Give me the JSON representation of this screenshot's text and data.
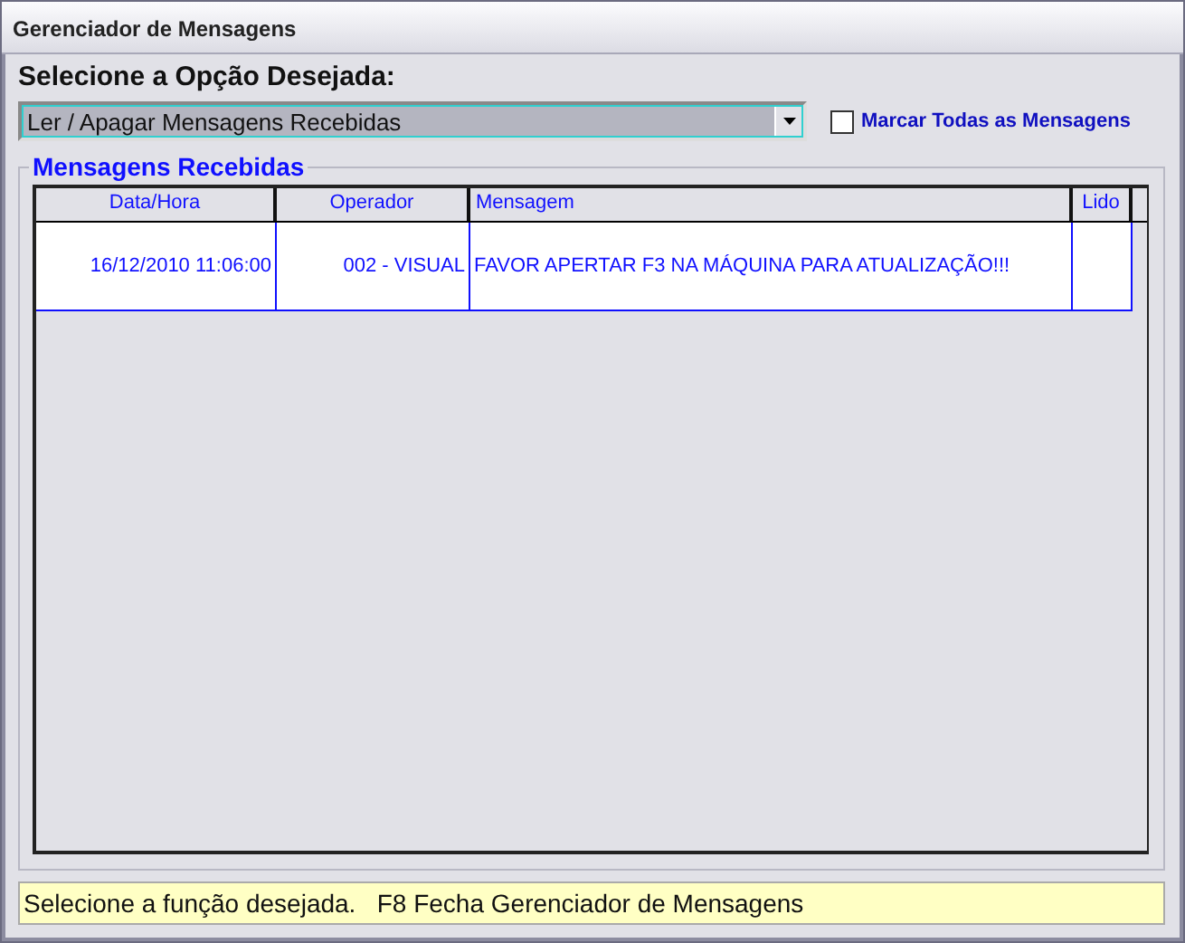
{
  "window": {
    "title": "Gerenciador de Mensagens"
  },
  "option": {
    "label": "Selecione a Opção Desejada:",
    "value": "Ler / Apagar Mensagens Recebidas"
  },
  "mark_all": {
    "label": "Marcar Todas as Mensagens",
    "checked": false
  },
  "group": {
    "title": "Mensagens Recebidas"
  },
  "table": {
    "columns": [
      "Data/Hora",
      "Operador",
      "Mensagem",
      "Lido"
    ],
    "rows": [
      {
        "cells": [
          "16/12/2010 11:06:00",
          "002 - VISUAL",
          "FAVOR APERTAR F3 NA MÁQUINA PARA ATUALIZAÇÃO!!!",
          ""
        ]
      }
    ]
  },
  "status_bar": "Selecione a função desejada.   F8 Fecha Gerenciador de Mensagens"
}
